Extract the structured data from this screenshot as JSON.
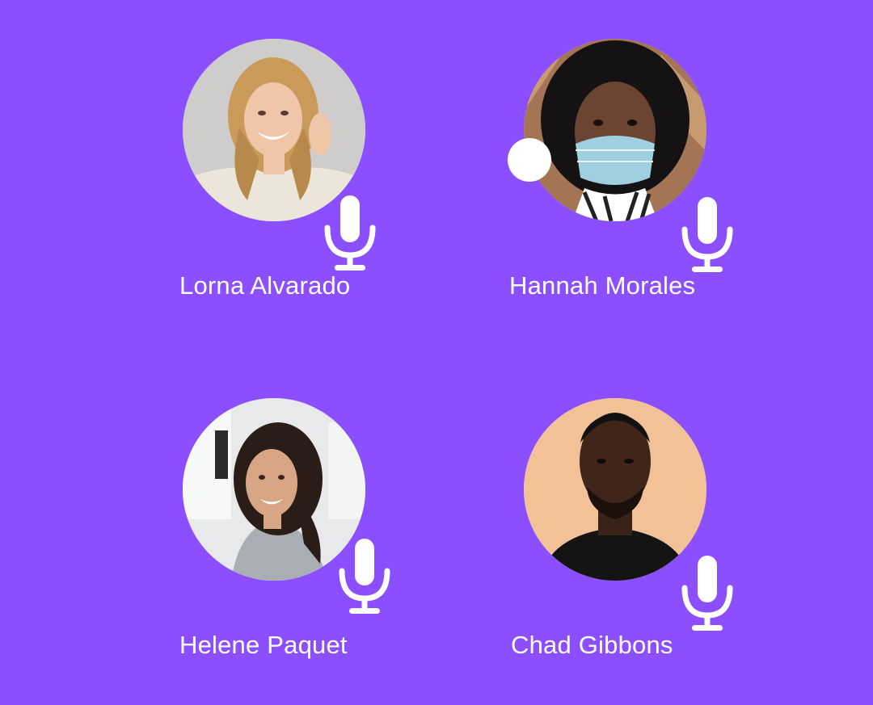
{
  "colors": {
    "background": "#8c4fff",
    "text": "#ffffff",
    "mic": "#ffffff"
  },
  "participants": [
    {
      "name": "Lorna Alvarado",
      "mic_icon": "microphone-icon",
      "speaking": false
    },
    {
      "name": "Hannah Morales",
      "mic_icon": "microphone-icon",
      "speaking": true
    },
    {
      "name": "Helene Paquet",
      "mic_icon": "microphone-icon",
      "speaking": false
    },
    {
      "name": "Chad Gibbons",
      "mic_icon": "microphone-icon",
      "speaking": false
    }
  ]
}
